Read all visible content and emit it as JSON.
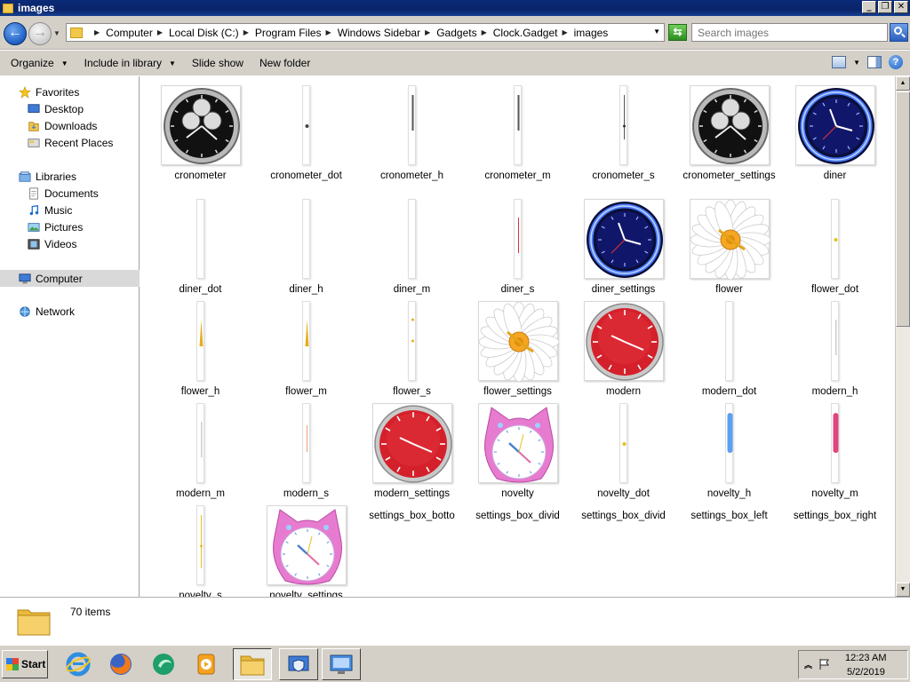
{
  "window": {
    "title": "images",
    "icon": "folder-icon",
    "minimize": "_",
    "maximize": "❐",
    "close": "✕"
  },
  "address": {
    "crumbs": [
      "Computer",
      "Local Disk (C:)",
      "Program Files",
      "Windows Sidebar",
      "Gadgets",
      "Clock.Gadget",
      "images"
    ],
    "search_placeholder": "Search images"
  },
  "toolbar": {
    "organize": "Organize",
    "include": "Include in library",
    "slideshow": "Slide show",
    "newfolder": "New folder"
  },
  "nav": {
    "favorites": "Favorites",
    "fav_items": [
      "Desktop",
      "Downloads",
      "Recent Places"
    ],
    "libraries": "Libraries",
    "lib_items": [
      "Documents",
      "Music",
      "Pictures",
      "Videos"
    ],
    "computer": "Computer",
    "network": "Network"
  },
  "files": [
    {
      "name": "cronometer",
      "kind": "clock",
      "style": "cronometer"
    },
    {
      "name": "cronometer_dot",
      "kind": "strip",
      "style": "dot-dark"
    },
    {
      "name": "cronometer_h",
      "kind": "strip",
      "style": "hand-dark"
    },
    {
      "name": "cronometer_m",
      "kind": "strip",
      "style": "hand-dark"
    },
    {
      "name": "cronometer_s",
      "kind": "strip",
      "style": "hand-thin"
    },
    {
      "name": "cronometer_settings",
      "kind": "clock",
      "style": "cronometer"
    },
    {
      "name": "diner",
      "kind": "clock",
      "style": "diner"
    },
    {
      "name": "diner_dot",
      "kind": "strip",
      "style": "blank"
    },
    {
      "name": "diner_h",
      "kind": "strip",
      "style": "blank"
    },
    {
      "name": "diner_m",
      "kind": "strip",
      "style": "blank"
    },
    {
      "name": "diner_s",
      "kind": "strip",
      "style": "hand-red"
    },
    {
      "name": "diner_settings",
      "kind": "clock",
      "style": "diner"
    },
    {
      "name": "flower",
      "kind": "clock",
      "style": "flower"
    },
    {
      "name": "flower_dot",
      "kind": "strip",
      "style": "dot-yellow"
    },
    {
      "name": "flower_h",
      "kind": "strip",
      "style": "hand-yellow"
    },
    {
      "name": "flower_m",
      "kind": "strip",
      "style": "hand-yellow"
    },
    {
      "name": "flower_s",
      "kind": "strip",
      "style": "dots-yellow"
    },
    {
      "name": "flower_settings",
      "kind": "clock",
      "style": "flower"
    },
    {
      "name": "modern",
      "kind": "clock",
      "style": "modern"
    },
    {
      "name": "modern_dot",
      "kind": "strip",
      "style": "blank"
    },
    {
      "name": "modern_h",
      "kind": "strip",
      "style": "hand-grey"
    },
    {
      "name": "modern_m",
      "kind": "strip",
      "style": "hand-grey"
    },
    {
      "name": "modern_s",
      "kind": "strip",
      "style": "hand-orange"
    },
    {
      "name": "modern_settings",
      "kind": "clock",
      "style": "modern"
    },
    {
      "name": "novelty",
      "kind": "clock",
      "style": "novelty"
    },
    {
      "name": "novelty_dot",
      "kind": "strip",
      "style": "dot-yellow"
    },
    {
      "name": "novelty_h",
      "kind": "strip",
      "style": "bar-blue"
    },
    {
      "name": "novelty_m",
      "kind": "strip",
      "style": "bar-pink"
    },
    {
      "name": "novelty_s",
      "kind": "strip",
      "style": "hand-yellow-thin"
    },
    {
      "name": "novelty_settings",
      "kind": "clock",
      "style": "novelty"
    },
    {
      "name": "settings_box_botto",
      "kind": "partial",
      "style": "blank"
    },
    {
      "name": "settings_box_divid",
      "kind": "partial",
      "style": "blank"
    },
    {
      "name": "settings_box_divid",
      "kind": "partial",
      "style": "blank"
    },
    {
      "name": "settings_box_left",
      "kind": "partial",
      "style": "blank"
    },
    {
      "name": "settings_box_right",
      "kind": "partial",
      "style": "blank"
    }
  ],
  "details": {
    "count": "70 items"
  },
  "taskbar": {
    "start": "Start",
    "apps": [
      "internet-explorer-icon",
      "firefox-icon",
      "media-center-icon",
      "media-player-icon",
      "windows-explorer-icon",
      "security-center-icon",
      "remote-desktop-icon"
    ],
    "time": "12:23 AM",
    "date": "5/2/2019"
  }
}
